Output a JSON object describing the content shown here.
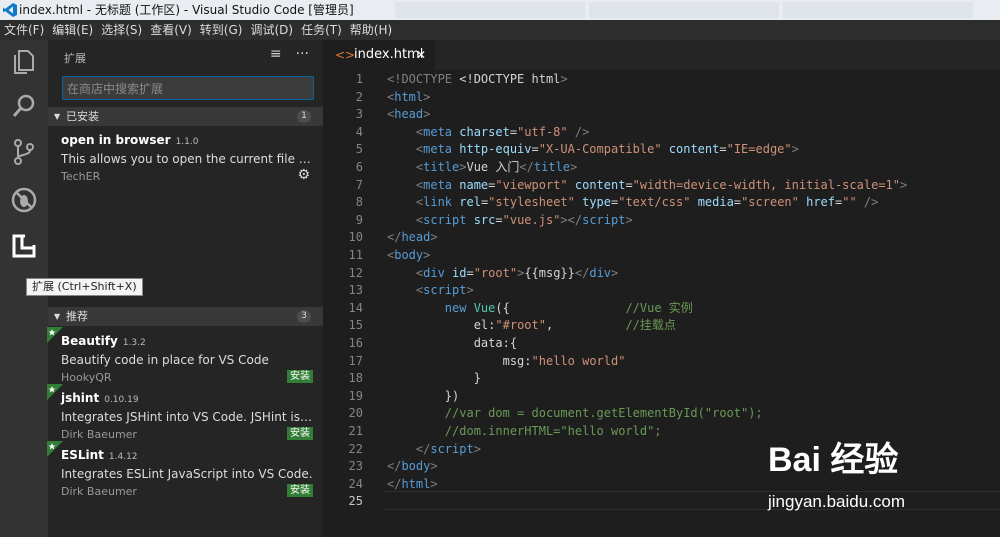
{
  "window": {
    "title": "index.html - 无标题 (工作区) - Visual Studio Code [管理员]"
  },
  "menu": [
    "文件(F)",
    "编辑(E)",
    "选择(S)",
    "查看(V)",
    "转到(G)",
    "调试(D)",
    "任务(T)",
    "帮助(H)"
  ],
  "activity": {
    "tooltip": "扩展 (Ctrl+Shift+X)"
  },
  "sidebar": {
    "title": "扩展",
    "search_placeholder": "在商店中搜索扩展",
    "installed": {
      "label": "已安装",
      "count": "1",
      "items": [
        {
          "name": "open in browser",
          "version": "1.1.0",
          "desc": "This allows you to open the current file in your default browser",
          "publisher": "TechER"
        }
      ]
    },
    "recommended": {
      "label": "推荐",
      "count": "3",
      "install_label": "安装",
      "items": [
        {
          "name": "Beautify",
          "version": "1.3.2",
          "desc": "Beautify code in place for VS Code",
          "publisher": "HookyQR"
        },
        {
          "name": "jshint",
          "version": "0.10.19",
          "desc": "Integrates JSHint into VS Code. JSHint is a linter for JavaScript",
          "publisher": "Dirk Baeumer"
        },
        {
          "name": "ESLint",
          "version": "1.4.12",
          "desc": "Integrates ESLint JavaScript into VS Code.",
          "publisher": "Dirk Baeumer"
        }
      ]
    }
  },
  "editor": {
    "tab": {
      "label": "index.html"
    },
    "lines": [
      [
        [
          "<!DOCTYPE ",
          "#808080"
        ],
        [
          "<!DOCTYPE html",
          "#d4d4d4"
        ],
        [
          ">",
          "#808080"
        ]
      ],
      [
        [
          "<",
          "#808080"
        ],
        [
          "html",
          "#569cd6"
        ],
        [
          ">",
          "#808080"
        ]
      ],
      [
        [
          "<",
          "#808080"
        ],
        [
          "head",
          "#569cd6"
        ],
        [
          ">",
          "#808080"
        ]
      ],
      [
        [
          "    <",
          "#808080"
        ],
        [
          "meta ",
          "#569cd6"
        ],
        [
          "charset",
          "#9cdcfe"
        ],
        [
          "=",
          "#d4d4d4"
        ],
        [
          "\"utf-8\"",
          "#ce9178"
        ],
        [
          " />",
          "#808080"
        ]
      ],
      [
        [
          "    <",
          "#808080"
        ],
        [
          "meta ",
          "#569cd6"
        ],
        [
          "http-equiv",
          "#9cdcfe"
        ],
        [
          "=",
          "#d4d4d4"
        ],
        [
          "\"X-UA-Compatible\"",
          "#ce9178"
        ],
        [
          " content",
          "#9cdcfe"
        ],
        [
          "=",
          "#d4d4d4"
        ],
        [
          "\"IE=edge\"",
          "#ce9178"
        ],
        [
          ">",
          "#808080"
        ]
      ],
      [
        [
          "    <",
          "#808080"
        ],
        [
          "title",
          "#569cd6"
        ],
        [
          ">",
          "#808080"
        ],
        [
          "Vue 入门",
          "#d4d4d4"
        ],
        [
          "</",
          "#808080"
        ],
        [
          "title",
          "#569cd6"
        ],
        [
          ">",
          "#808080"
        ]
      ],
      [
        [
          "    <",
          "#808080"
        ],
        [
          "meta ",
          "#569cd6"
        ],
        [
          "name",
          "#9cdcfe"
        ],
        [
          "=",
          "#d4d4d4"
        ],
        [
          "\"viewport\"",
          "#ce9178"
        ],
        [
          " content",
          "#9cdcfe"
        ],
        [
          "=",
          "#d4d4d4"
        ],
        [
          "\"width=device-width, initial-scale=1\"",
          "#ce9178"
        ],
        [
          ">",
          "#808080"
        ]
      ],
      [
        [
          "    <",
          "#808080"
        ],
        [
          "link ",
          "#569cd6"
        ],
        [
          "rel",
          "#9cdcfe"
        ],
        [
          "=",
          "#d4d4d4"
        ],
        [
          "\"stylesheet\"",
          "#ce9178"
        ],
        [
          " type",
          "#9cdcfe"
        ],
        [
          "=",
          "#d4d4d4"
        ],
        [
          "\"text/css\"",
          "#ce9178"
        ],
        [
          " media",
          "#9cdcfe"
        ],
        [
          "=",
          "#d4d4d4"
        ],
        [
          "\"screen\"",
          "#ce9178"
        ],
        [
          " href",
          "#9cdcfe"
        ],
        [
          "=",
          "#d4d4d4"
        ],
        [
          "\"\"",
          "#ce9178"
        ],
        [
          " />",
          "#808080"
        ]
      ],
      [
        [
          "    <",
          "#808080"
        ],
        [
          "script ",
          "#569cd6"
        ],
        [
          "src",
          "#9cdcfe"
        ],
        [
          "=",
          "#d4d4d4"
        ],
        [
          "\"vue.js\"",
          "#ce9178"
        ],
        [
          "></",
          "#808080"
        ],
        [
          "script",
          "#569cd6"
        ],
        [
          ">",
          "#808080"
        ]
      ],
      [
        [
          "</",
          "#808080"
        ],
        [
          "head",
          "#569cd6"
        ],
        [
          ">",
          "#808080"
        ]
      ],
      [
        [
          "<",
          "#808080"
        ],
        [
          "body",
          "#569cd6"
        ],
        [
          ">",
          "#808080"
        ]
      ],
      [
        [
          "    <",
          "#808080"
        ],
        [
          "div ",
          "#569cd6"
        ],
        [
          "id",
          "#9cdcfe"
        ],
        [
          "=",
          "#d4d4d4"
        ],
        [
          "\"root\"",
          "#ce9178"
        ],
        [
          ">",
          "#808080"
        ],
        [
          "{{msg}}",
          "#d4d4d4"
        ],
        [
          "</",
          "#808080"
        ],
        [
          "div",
          "#569cd6"
        ],
        [
          ">",
          "#808080"
        ]
      ],
      [
        [
          "    <",
          "#808080"
        ],
        [
          "script",
          "#569cd6"
        ],
        [
          ">",
          "#808080"
        ]
      ],
      [
        [
          "        new ",
          "#569cd6"
        ],
        [
          "Vue",
          "#4ec9b0"
        ],
        [
          "({                ",
          "#d4d4d4"
        ],
        [
          "//Vue 实例",
          "#6a9955"
        ]
      ],
      [
        [
          "            el",
          "#d4d4d4"
        ],
        [
          ":",
          "#d4d4d4"
        ],
        [
          "\"#root\"",
          "#ce9178"
        ],
        [
          ",          ",
          "#d4d4d4"
        ],
        [
          "//挂载点",
          "#6a9955"
        ]
      ],
      [
        [
          "            data",
          "#d4d4d4"
        ],
        [
          ":{",
          "#d4d4d4"
        ]
      ],
      [
        [
          "                msg",
          "#d4d4d4"
        ],
        [
          ":",
          "#d4d4d4"
        ],
        [
          "\"hello world\"",
          "#ce9178"
        ]
      ],
      [
        [
          "            }",
          "#d4d4d4"
        ]
      ],
      [
        [
          "        })",
          "#d4d4d4"
        ]
      ],
      [
        [
          "        //var dom = document.getElementById(\"root\");",
          "#6a9955"
        ]
      ],
      [
        [
          "        //dom.innerHTML=\"hello world\";",
          "#6a9955"
        ]
      ],
      [
        [
          "    </",
          "#808080"
        ],
        [
          "script",
          "#569cd6"
        ],
        [
          ">",
          "#808080"
        ]
      ],
      [
        [
          "</",
          "#808080"
        ],
        [
          "body",
          "#569cd6"
        ],
        [
          ">",
          "#808080"
        ]
      ],
      [
        [
          "</",
          "#808080"
        ],
        [
          "html",
          "#569cd6"
        ],
        [
          ">",
          "#808080"
        ]
      ],
      [
        [
          "",
          "#d4d4d4"
        ]
      ]
    ]
  },
  "watermark": {
    "brand": "Bai 经验",
    "site": "jingyan.baidu.com"
  }
}
